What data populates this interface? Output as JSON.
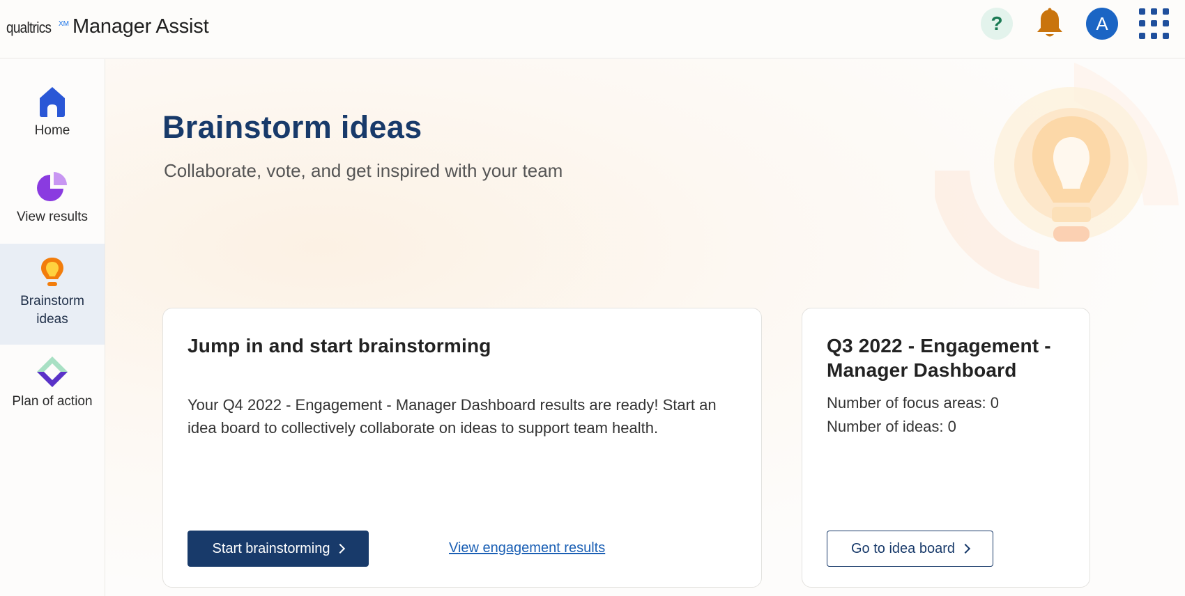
{
  "header": {
    "logo_text": "qualtrics",
    "logo_badge": "XM",
    "app_title": "Manager Assist",
    "help_label": "?",
    "avatar_initial": "A"
  },
  "sidebar": {
    "items": [
      {
        "label": "Home",
        "icon": "home-icon",
        "active": false
      },
      {
        "label": "View results",
        "icon": "pie-chart-icon",
        "active": false
      },
      {
        "label": "Brainstorm ideas",
        "icon": "lightbulb-icon",
        "active": true
      },
      {
        "label": "Plan of action",
        "icon": "diamond-plan-icon",
        "active": false
      }
    ]
  },
  "main": {
    "title": "Brainstorm ideas",
    "subtitle": "Collaborate, vote, and get inspired with your team",
    "start_card": {
      "title": "Jump in and start brainstorming",
      "description": "Your Q4 2022 - Engagement - Manager Dashboard results are ready! Start an idea board to collectively collaborate on ideas to support team health.",
      "primary_button": "Start brainstorming",
      "secondary_link": "View engagement results"
    },
    "board_card": {
      "title": "Q3 2022 - Engagement - Manager Dashboard",
      "focus_areas": "Number of focus areas: 0",
      "ideas": "Number of ideas: 0",
      "button": "Go to idea board"
    }
  },
  "colors": {
    "brand_navy": "#183a6a",
    "help_bg": "#e3f3ec",
    "help_fg": "#1b7a54",
    "bell": "#c9740d",
    "avatar": "#1b65c4",
    "active_nav_bg": "#e9eef5"
  }
}
